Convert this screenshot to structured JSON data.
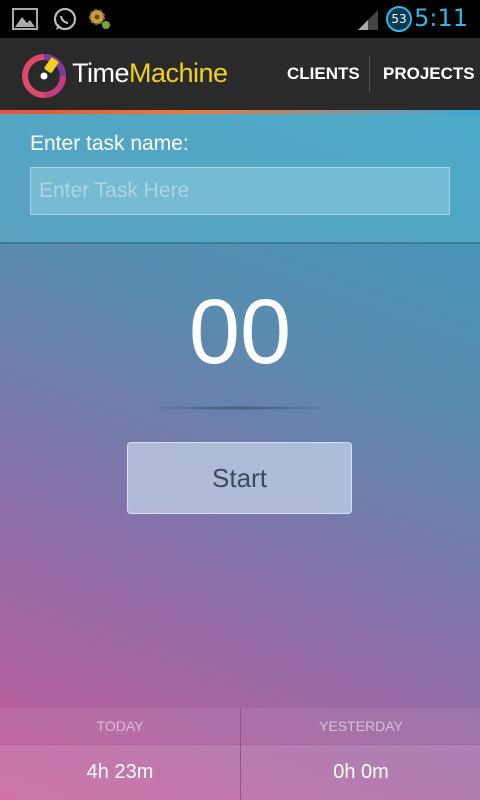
{
  "status_bar": {
    "time": "5:11",
    "notification_badge": "53",
    "icons": [
      "gallery-icon",
      "whatsapp-icon",
      "settings-gear-icon",
      "signal-icon"
    ]
  },
  "action_bar": {
    "brand_part1": "Time",
    "brand_part2": "Machine",
    "nav": {
      "clients": "CLIENTS",
      "projects": "PROJECTS"
    }
  },
  "task": {
    "label": "Enter task name:",
    "placeholder": "Enter Task Here",
    "value": ""
  },
  "timer": {
    "display": "00"
  },
  "start_button": "Start",
  "stats": {
    "today_label": "TODAY",
    "today_value": "4h 23m",
    "yesterday_label": "YESTERDAY",
    "yesterday_value": "0h 0m"
  },
  "colors": {
    "status_time": "#33b5e5",
    "brand_accent": "#f0d020",
    "action_bar_bg": "#2a2a2a"
  }
}
